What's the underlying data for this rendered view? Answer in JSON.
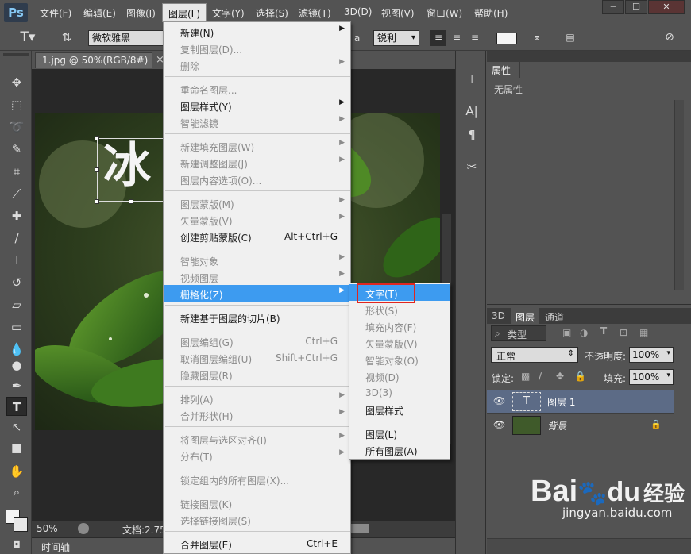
{
  "app": {
    "logo": "Ps"
  },
  "menubar": {
    "items": [
      "文件(F)",
      "编辑(E)",
      "图像(I)",
      "图层(L)",
      "文字(Y)",
      "选择(S)",
      "滤镜(T)",
      "3D(D)",
      "视图(V)",
      "窗口(W)",
      "帮助(H)"
    ],
    "window_buttons": [
      "─",
      "☐",
      "✕"
    ]
  },
  "options_bar": {
    "font_family": "微软雅黑",
    "antialias": "锐利",
    "aa_label": "a"
  },
  "document": {
    "tab_title": "1.jpg @ 50%(RGB/8#)",
    "close_glyph": "×",
    "canvas_text": "冰",
    "zoom": "50%",
    "doc_info": "文档:2.75"
  },
  "timeline": {
    "label": "时间轴"
  },
  "properties_panel": {
    "tab": "属性",
    "empty_text": "无属性"
  },
  "layers_panel": {
    "tabs": [
      "3D",
      "图层",
      "通道"
    ],
    "filter_kind": "类型",
    "blend_mode": "正常",
    "opacity_label": "不透明度:",
    "opacity_value": "100%",
    "lock_label": "锁定:",
    "fill_label": "填充:",
    "fill_value": "100%",
    "layers": [
      {
        "name": "图层 1",
        "type": "text",
        "selected": true
      },
      {
        "name": "背景",
        "type": "image",
        "selected": false
      }
    ]
  },
  "layer_menu": {
    "groups": [
      [
        {
          "label": "新建(N)",
          "enabled": true,
          "submenu": true
        },
        {
          "label": "复制图层(D)...",
          "enabled": false
        },
        {
          "label": "删除",
          "enabled": false,
          "submenu": true
        }
      ],
      [
        {
          "label": "重命名图层...",
          "enabled": false
        },
        {
          "label": "图层样式(Y)",
          "enabled": true,
          "submenu": true
        },
        {
          "label": "智能滤镜",
          "enabled": false,
          "submenu": true
        }
      ],
      [
        {
          "label": "新建填充图层(W)",
          "enabled": false,
          "submenu": true
        },
        {
          "label": "新建调整图层(J)",
          "enabled": false,
          "submenu": true
        },
        {
          "label": "图层内容选项(O)...",
          "enabled": false
        }
      ],
      [
        {
          "label": "图层蒙版(M)",
          "enabled": false,
          "submenu": true
        },
        {
          "label": "矢量蒙版(V)",
          "enabled": false,
          "submenu": true
        },
        {
          "label": "创建剪贴蒙版(C)",
          "enabled": true,
          "shortcut": "Alt+Ctrl+G"
        }
      ],
      [
        {
          "label": "智能对象",
          "enabled": false,
          "submenu": true
        },
        {
          "label": "视频图层",
          "enabled": false,
          "submenu": true
        },
        {
          "label": "栅格化(Z)",
          "enabled": true,
          "submenu": true,
          "highlighted": true
        }
      ],
      [
        {
          "label": "新建基于图层的切片(B)",
          "enabled": true
        }
      ],
      [
        {
          "label": "图层编组(G)",
          "enabled": false,
          "shortcut": "Ctrl+G"
        },
        {
          "label": "取消图层编组(U)",
          "enabled": false,
          "shortcut": "Shift+Ctrl+G"
        },
        {
          "label": "隐藏图层(R)",
          "enabled": false
        }
      ],
      [
        {
          "label": "排列(A)",
          "enabled": false,
          "submenu": true
        },
        {
          "label": "合并形状(H)",
          "enabled": false,
          "submenu": true
        }
      ],
      [
        {
          "label": "将图层与选区对齐(I)",
          "enabled": false,
          "submenu": true
        },
        {
          "label": "分布(T)",
          "enabled": false,
          "submenu": true
        }
      ],
      [
        {
          "label": "锁定组内的所有图层(X)...",
          "enabled": false
        }
      ],
      [
        {
          "label": "链接图层(K)",
          "enabled": false
        },
        {
          "label": "选择链接图层(S)",
          "enabled": false
        }
      ],
      [
        {
          "label": "合并图层(E)",
          "enabled": true,
          "shortcut": "Ctrl+E"
        }
      ]
    ]
  },
  "rasterize_submenu": {
    "groups": [
      [
        {
          "label": "文字(T)",
          "enabled": true,
          "highlighted": true
        },
        {
          "label": "形状(S)",
          "enabled": false
        },
        {
          "label": "填充内容(F)",
          "enabled": false
        },
        {
          "label": "矢量蒙版(V)",
          "enabled": false
        },
        {
          "label": "智能对象(O)",
          "enabled": false
        },
        {
          "label": "视频(D)",
          "enabled": false
        },
        {
          "label": "3D(3)",
          "enabled": false
        },
        {
          "label": "图层样式",
          "enabled": true
        }
      ],
      [
        {
          "label": "图层(L)",
          "enabled": true
        },
        {
          "label": "所有图层(A)",
          "enabled": true
        }
      ]
    ]
  },
  "watermark": {
    "brand": "Bai",
    "brand2": "du",
    "product": "经验",
    "url": "jingyan.baidu.com"
  },
  "icons": [
    "text-tool-icon",
    "move-tool-icon",
    "marquee-tool-icon",
    "lasso-tool-icon",
    "quick-select-icon",
    "crop-tool-icon",
    "eyedropper-icon",
    "healing-brush-icon",
    "brush-tool-icon",
    "clone-stamp-icon",
    "history-brush-icon",
    "eraser-icon",
    "gradient-tool-icon",
    "blur-tool-icon",
    "dodge-tool-icon",
    "pen-tool-icon",
    "type-tool-icon",
    "path-select-icon",
    "shape-tool-icon",
    "hand-tool-icon",
    "zoom-tool-icon",
    "eye-icon",
    "lock-icon",
    "paw-icon"
  ],
  "colors": {
    "menu_highlight": "#3d9bf0",
    "callout_border": "#e0251f",
    "panel_bg": "#535353"
  }
}
